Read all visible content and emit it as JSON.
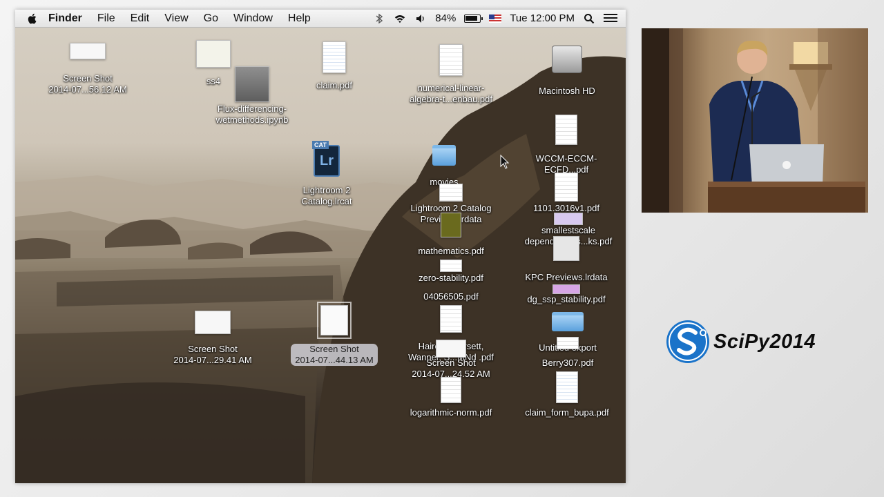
{
  "menubar": {
    "apple_icon": "apple-icon",
    "app_name": "Finder",
    "menus": [
      "File",
      "Edit",
      "View",
      "Go",
      "Window",
      "Help"
    ],
    "status": {
      "battery_percent": "84%",
      "clock": "Tue 12:00 PM",
      "icons": [
        "bluetooth-icon",
        "wifi-icon",
        "volume-icon",
        "battery-icon",
        "flag-icon",
        "spotlight-icon",
        "notification-list-icon"
      ]
    }
  },
  "desktop": {
    "icons": [
      {
        "label": "Screen Shot\n2014-07...56.12 AM",
        "kind": "screenshot"
      },
      {
        "label": "ss4",
        "kind": "image"
      },
      {
        "label": "Flux-differencing-\nwetmethods.ipynb",
        "kind": "notebook"
      },
      {
        "label": "claim.pdf",
        "kind": "pdf"
      },
      {
        "label": "numerical-linear-\nalgebra-t...enbau.pdf",
        "kind": "pdf"
      },
      {
        "label": "Macintosh HD",
        "kind": "drive"
      },
      {
        "label": "Lightroom 2\nCatalog.lrcat",
        "kind": "lightroom"
      },
      {
        "label": "movies",
        "kind": "folder"
      },
      {
        "label": "WCCM-ECCM-\nECFD...pdf",
        "kind": "pdf"
      },
      {
        "label": "Lightroom 2 Catalog\nPreviews.lrdata",
        "kind": "data"
      },
      {
        "label": "1101.3016v1.pdf",
        "kind": "pdf"
      },
      {
        "label": "smallestscale\ndependencies...ks.pdf",
        "kind": "pdf"
      },
      {
        "label": "mathematics.pdf",
        "kind": "pdf"
      },
      {
        "label": "zero-stability.pdf",
        "kind": "pdf"
      },
      {
        "label": "KPC Previews.lrdata",
        "kind": "data"
      },
      {
        "label": "04056505.pdf",
        "kind": "pdf"
      },
      {
        "label": "dg_ssp_stability.pdf",
        "kind": "pdf"
      },
      {
        "label": "Screen Shot\n2014-07...29.41 AM",
        "kind": "screenshot"
      },
      {
        "label": "Screen Shot\n2014-07...44.13 AM",
        "kind": "screenshot",
        "selected": true
      },
      {
        "label": "Hairer, Noersett,\nWanner, S...MNd .pdf",
        "kind": "pdf"
      },
      {
        "label": "Screen Shot\n2014-07...24.52 AM",
        "kind": "screenshot"
      },
      {
        "label": "Untitled export",
        "kind": "folder"
      },
      {
        "label": "Berry307.pdf",
        "kind": "pdf"
      },
      {
        "label": "logarithmic-norm.pdf",
        "kind": "pdf"
      },
      {
        "label": "claim_form_bupa.pdf",
        "kind": "pdf"
      }
    ]
  },
  "video": {
    "description_icon": "speaker-video"
  },
  "logo": {
    "text": "SciPy2014",
    "brand_color": "#1a73c9"
  },
  "colors": {
    "menubar": "#e9e9e9",
    "label_text": "#ffffff",
    "logo_blue": "#1a73c9"
  }
}
